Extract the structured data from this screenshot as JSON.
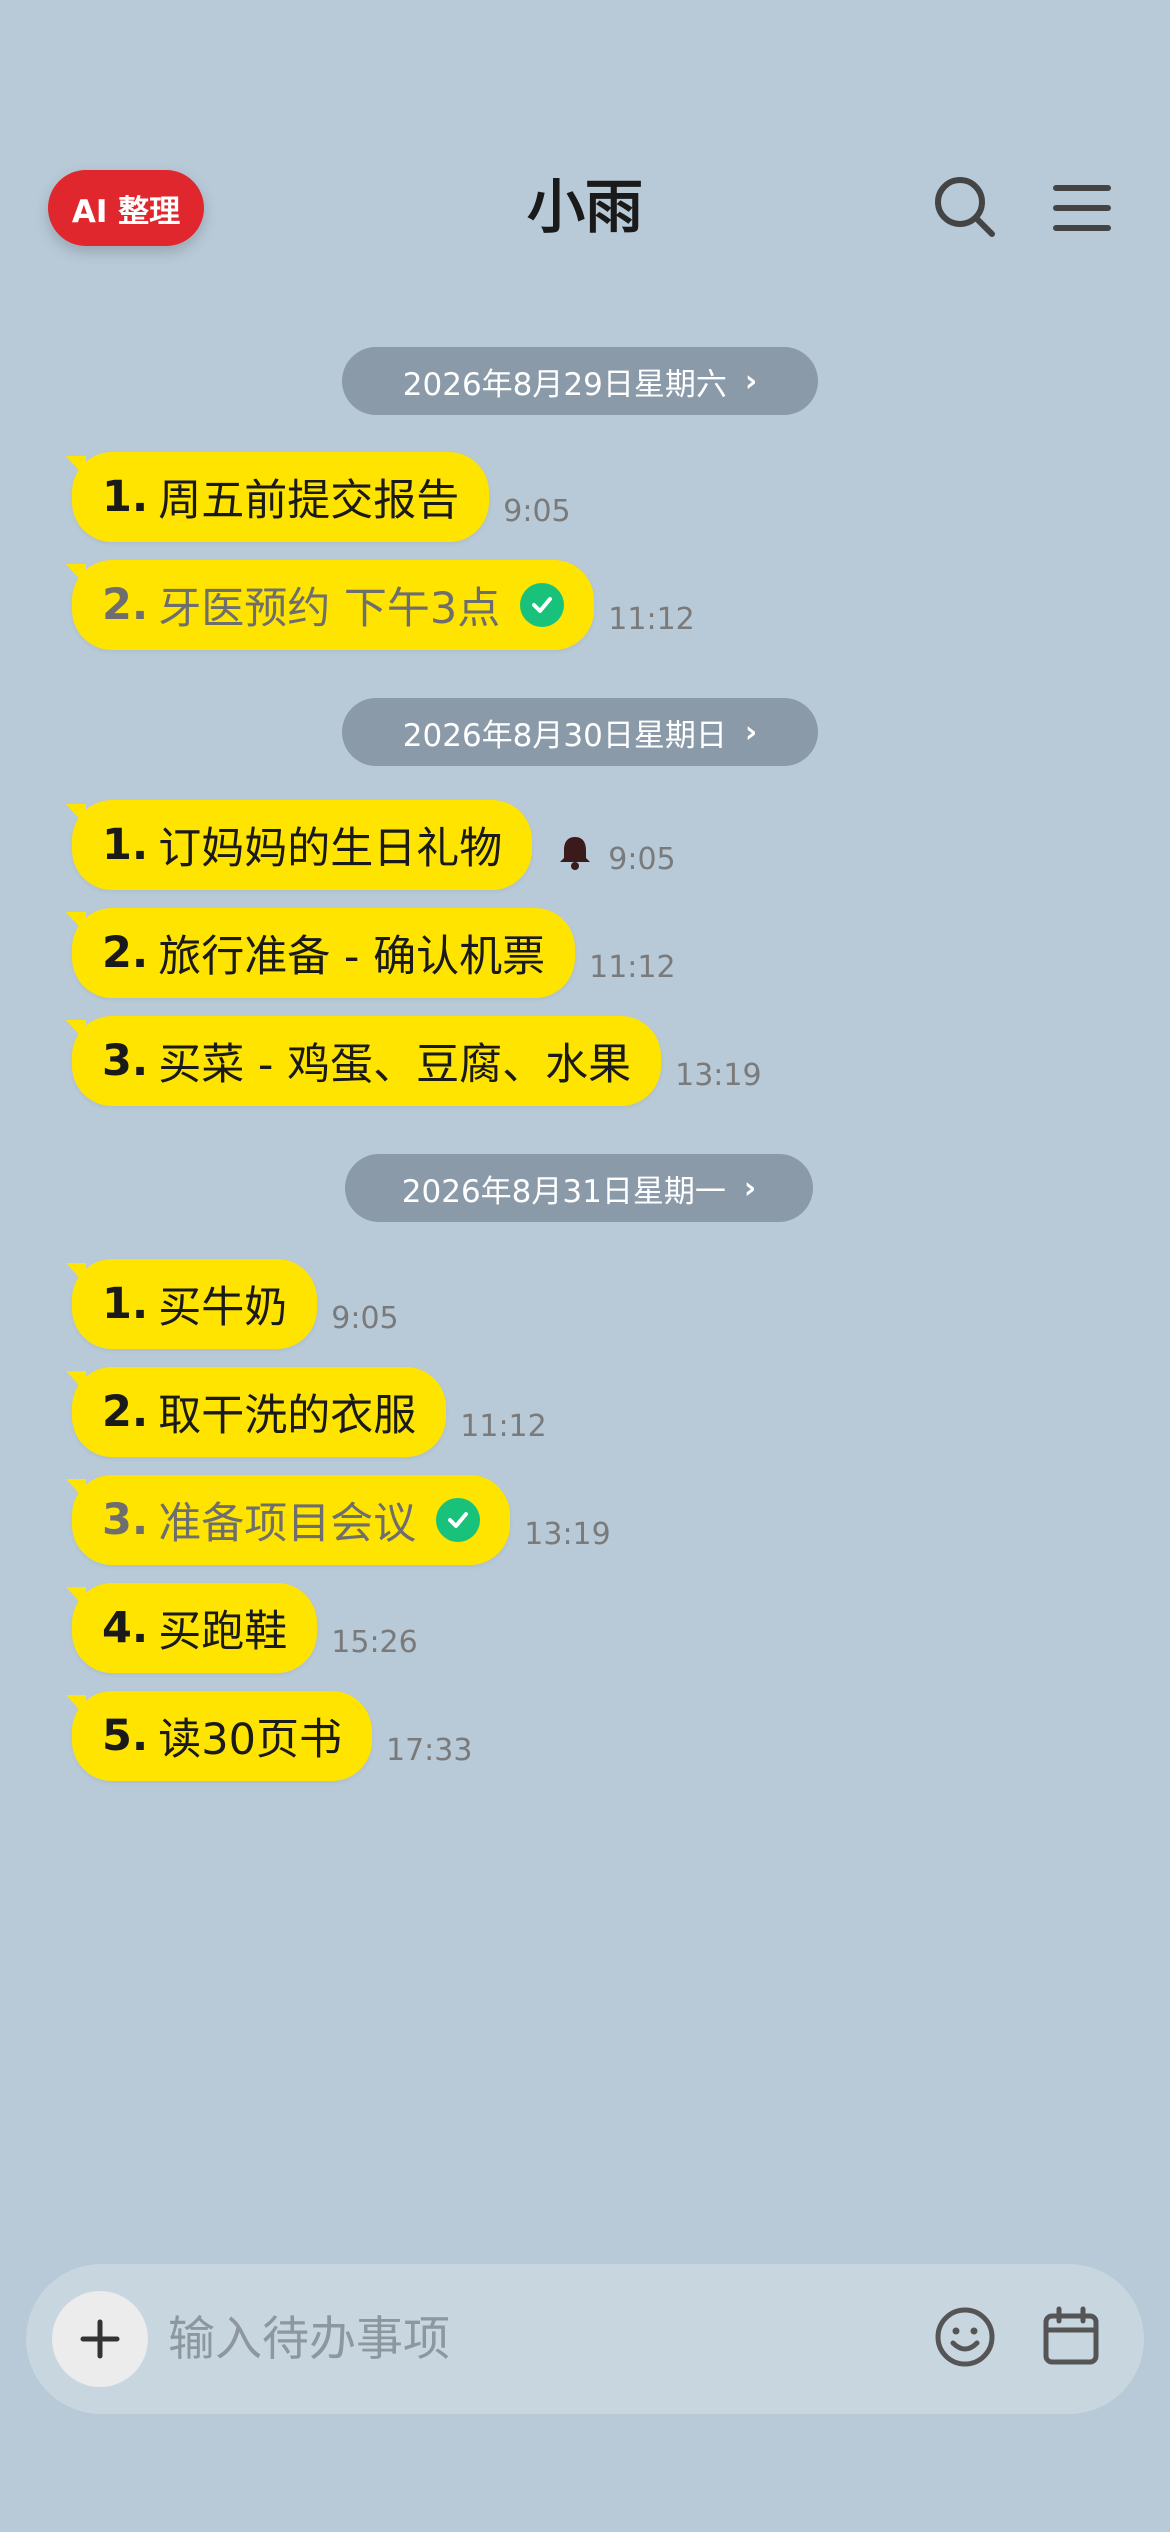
{
  "header": {
    "ai_button_label": "AI 整理",
    "title": "小雨",
    "icons": [
      "search-icon",
      "menu-icon"
    ]
  },
  "groups": [
    {
      "date_label": "2026年8月29日星期六",
      "items": [
        {
          "num": "1.",
          "text": "周五前提交报告",
          "time": "9:05",
          "done": false
        },
        {
          "num": "2.",
          "text": "牙医预约 下午3点",
          "time": "11:12",
          "done": true
        }
      ]
    },
    {
      "date_label": "2026年8月30日星期日",
      "items": [
        {
          "num": "1.",
          "text": "订妈妈的生日礼物",
          "time": "9:05",
          "done": false,
          "reminder": true
        },
        {
          "num": "2.",
          "text": "旅行准备 - 确认机票",
          "time": "11:12",
          "done": false
        },
        {
          "num": "3.",
          "text": "买菜 - 鸡蛋、豆腐、水果",
          "time": "13:19",
          "done": false
        }
      ]
    },
    {
      "date_label": "2026年8月31日星期一",
      "items": [
        {
          "num": "1.",
          "text": "买牛奶",
          "time": "9:05",
          "done": false
        },
        {
          "num": "2.",
          "text": "取干洗的衣服",
          "time": "11:12",
          "done": false
        },
        {
          "num": "3.",
          "text": "准备项目会议",
          "time": "13:19",
          "done": true
        },
        {
          "num": "4.",
          "text": "买跑鞋",
          "time": "15:26",
          "done": false
        },
        {
          "num": "5.",
          "text": "读30页书",
          "time": "17:33",
          "done": false
        }
      ]
    }
  ],
  "input": {
    "placeholder": "输入待办事项",
    "icons": [
      "plus-icon",
      "emoji-icon",
      "calendar-icon"
    ]
  },
  "colors": {
    "background": "#b8cad8",
    "bubble": "#ffe400",
    "ai_button": "#e0272d",
    "check": "#18c27a",
    "date_pill": "#8a9aa8"
  }
}
